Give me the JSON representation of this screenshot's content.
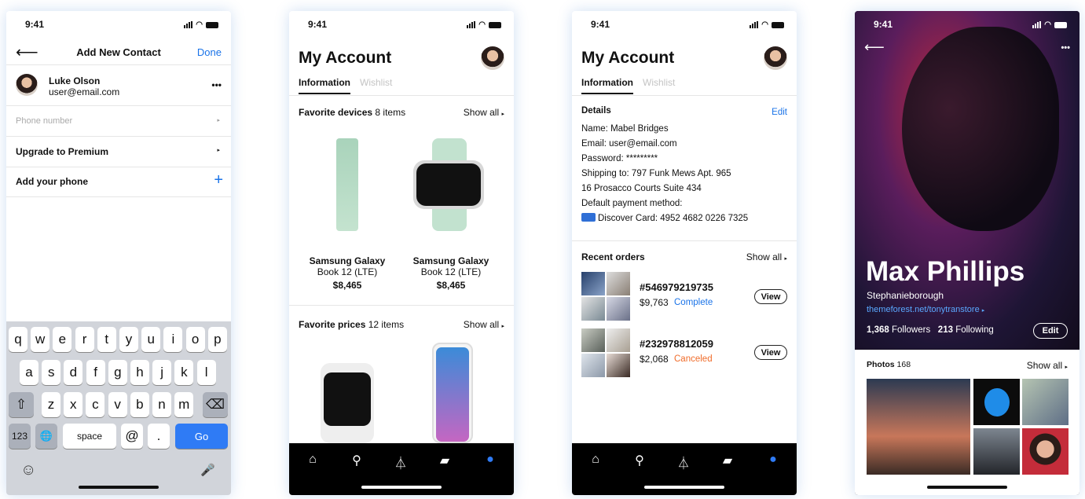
{
  "status": {
    "time": "9:41"
  },
  "contact": {
    "title": "Add New Contact",
    "done": "Done",
    "name": "Luke Olson",
    "email": "user@email.com",
    "more": "•••",
    "phone_placeholder": "Phone number",
    "premium": "Upgrade to Premium",
    "add_phone": "Add your phone",
    "plus": "+",
    "keyboard": {
      "row1": [
        "q",
        "w",
        "e",
        "r",
        "t",
        "y",
        "u",
        "i",
        "o",
        "p"
      ],
      "row2": [
        "a",
        "s",
        "d",
        "f",
        "g",
        "h",
        "j",
        "k",
        "l"
      ],
      "row3": [
        "z",
        "x",
        "c",
        "v",
        "b",
        "n",
        "m"
      ],
      "k123": "123",
      "space": "space",
      "at": "@",
      "dot": ".",
      "go": "Go"
    }
  },
  "account": {
    "title": "My Account",
    "tab_info": "Information",
    "tab_wish": "Wishlist",
    "fav_devices": "Favorite devices",
    "fav_devices_count": "8 items",
    "show_all": "Show all",
    "products": [
      {
        "name": "Samsung Galaxy",
        "sub": "Book 12 (LTE)",
        "price": "$8,465"
      },
      {
        "name": "Samsung Galaxy",
        "sub": "Book 12 (LTE)",
        "price": "$8,465"
      }
    ],
    "fav_prices": "Favorite prices",
    "fav_prices_count": "12 items"
  },
  "details": {
    "heading": "Details",
    "edit": "Edit",
    "lines": [
      "Name: Mabel Bridges",
      "Email: user@email.com",
      "Password: *********",
      "Shipping to: 797 Funk Mews Apt. 965",
      "16 Prosacco Courts Suite 434",
      "Default payment method:"
    ],
    "card": "Discover Card: 4952 4682 0226 7325",
    "recent": "Recent orders",
    "show_all": "Show all",
    "orders": [
      {
        "id": "#546979219735",
        "amount": "$9,763",
        "status": "Complete",
        "view": "View"
      },
      {
        "id": "#232978812059",
        "amount": "$2,068",
        "status": "Canceled",
        "view": "View"
      }
    ]
  },
  "profile": {
    "name": "Max Phillips",
    "location": "Stephanieborough",
    "link": "themeforest.net/tonytranstore",
    "followers_n": "1,368",
    "followers": "Followers",
    "following_n": "213",
    "following": "Following",
    "edit": "Edit",
    "photos": "Photos",
    "photos_count": "168",
    "show_all": "Show all",
    "more": "•••"
  },
  "colors": {
    "accent": "#1a73e8",
    "complete": "#1a73e8",
    "canceled": "#f06c2a"
  }
}
